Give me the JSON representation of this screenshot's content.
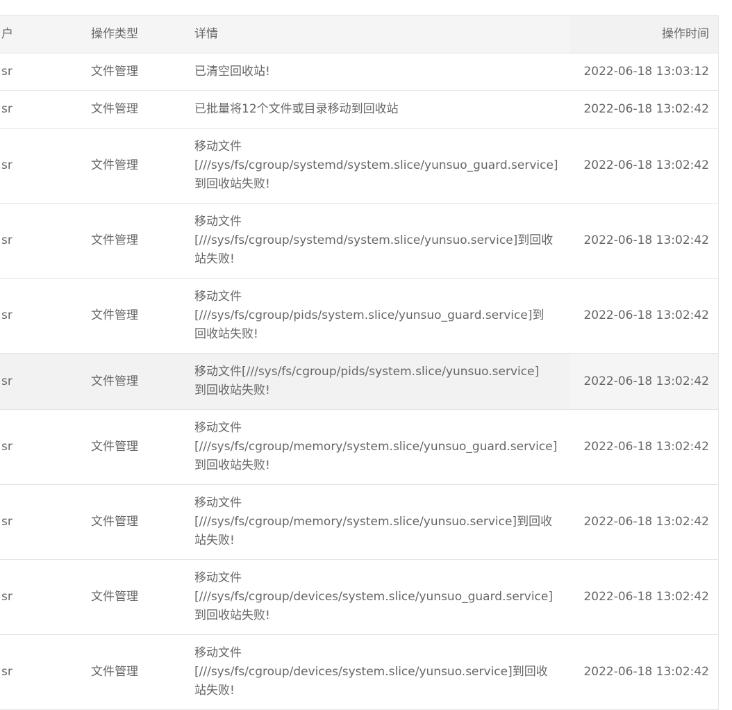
{
  "table": {
    "headers": {
      "user": "户",
      "type": "操作类型",
      "detail": "详情",
      "time": "操作时间"
    },
    "rows": [
      {
        "user": "sr",
        "type": "文件管理",
        "detail": "已清空回收站!",
        "time": "2022-06-18 13:03:12"
      },
      {
        "user": "sr",
        "type": "文件管理",
        "detail": "已批量将12个文件或目录移动到回收站",
        "time": "2022-06-18 13:02:42"
      },
      {
        "user": "sr",
        "type": "文件管理",
        "detail_lines": [
          "移动文件",
          "[///sys/fs/cgroup/systemd/system.slice/yunsuo_guard.service]",
          "到回收站失败!"
        ],
        "time": "2022-06-18 13:02:42"
      },
      {
        "user": "sr",
        "type": "文件管理",
        "detail_lines": [
          "移动文件",
          "[///sys/fs/cgroup/systemd/system.slice/yunsuo.service]到回收",
          "站失败!"
        ],
        "time": "2022-06-18 13:02:42"
      },
      {
        "user": "sr",
        "type": "文件管理",
        "detail_lines": [
          "移动文件",
          "[///sys/fs/cgroup/pids/system.slice/yunsuo_guard.service]到",
          "回收站失败!"
        ],
        "time": "2022-06-18 13:02:42"
      },
      {
        "user": "sr",
        "type": "文件管理",
        "detail_lines": [
          "移动文件[///sys/fs/cgroup/pids/system.slice/yunsuo.service]",
          "到回收站失败!"
        ],
        "time": "2022-06-18 13:02:42"
      },
      {
        "user": "sr",
        "type": "文件管理",
        "detail_lines": [
          "移动文件",
          "[///sys/fs/cgroup/memory/system.slice/yunsuo_guard.service]",
          "到回收站失败!"
        ],
        "time": "2022-06-18 13:02:42"
      },
      {
        "user": "sr",
        "type": "文件管理",
        "detail_lines": [
          "移动文件",
          "[///sys/fs/cgroup/memory/system.slice/yunsuo.service]到回收",
          "站失败!"
        ],
        "time": "2022-06-18 13:02:42"
      },
      {
        "user": "sr",
        "type": "文件管理",
        "detail_lines": [
          "移动文件",
          "[///sys/fs/cgroup/devices/system.slice/yunsuo_guard.service]",
          "到回收站失败!"
        ],
        "time": "2022-06-18 13:02:42"
      },
      {
        "user": "sr",
        "type": "文件管理",
        "detail_lines": [
          "移动文件",
          "[///sys/fs/cgroup/devices/system.slice/yunsuo.service]到回收",
          "站失败!"
        ],
        "time": "2022-06-18 13:02:42"
      }
    ]
  }
}
